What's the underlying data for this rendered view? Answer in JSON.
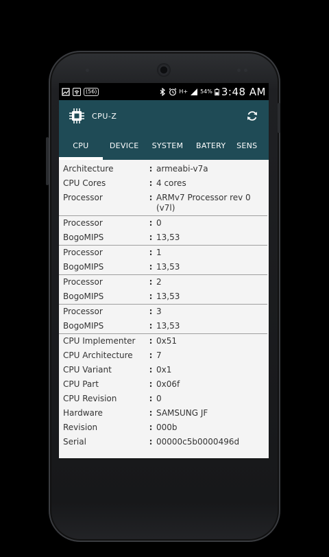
{
  "status_bar": {
    "left_icons": [
      "gallery-icon",
      "wifi-icon"
    ],
    "badge": "(56)",
    "network": "H+",
    "battery_percent": "54%",
    "time": "3:48 AM"
  },
  "app_bar": {
    "title": "CPU-Z"
  },
  "tabs": [
    {
      "label": "CPU",
      "active": true
    },
    {
      "label": "DEVICE",
      "active": false
    },
    {
      "label": "SYSTEM",
      "active": false
    },
    {
      "label": "BATERY",
      "active": false
    },
    {
      "label": "SENS",
      "active": false
    }
  ],
  "rows": [
    {
      "label": "Architecture",
      "value": "armeabi-v7a"
    },
    {
      "label": "CPU Cores",
      "value": "4 cores"
    },
    {
      "label": "Processor",
      "value": "ARMv7 Processor rev 0 (v7l)"
    },
    {
      "label": "Processor",
      "value": "0"
    },
    {
      "label": "BogoMIPS",
      "value": "13,53"
    },
    {
      "label": "Processor",
      "value": "1"
    },
    {
      "label": "BogoMIPS",
      "value": "13,53"
    },
    {
      "label": "Processor",
      "value": "2"
    },
    {
      "label": "BogoMIPS",
      "value": "13,53"
    },
    {
      "label": "Processor",
      "value": "3"
    },
    {
      "label": "BogoMIPS",
      "value": "13,53"
    },
    {
      "label": "CPU Implementer",
      "value": "0x51"
    },
    {
      "label": "CPU Architecture",
      "value": "7"
    },
    {
      "label": "CPU Variant",
      "value": "0x1"
    },
    {
      "label": "CPU Part",
      "value": "0x06f"
    },
    {
      "label": "CPU Revision",
      "value": "0"
    },
    {
      "label": "Hardware",
      "value": "SAMSUNG JF"
    },
    {
      "label": "Revision",
      "value": "000b"
    },
    {
      "label": "Serial",
      "value": "00000c5b0000496d"
    }
  ],
  "colon": ":"
}
